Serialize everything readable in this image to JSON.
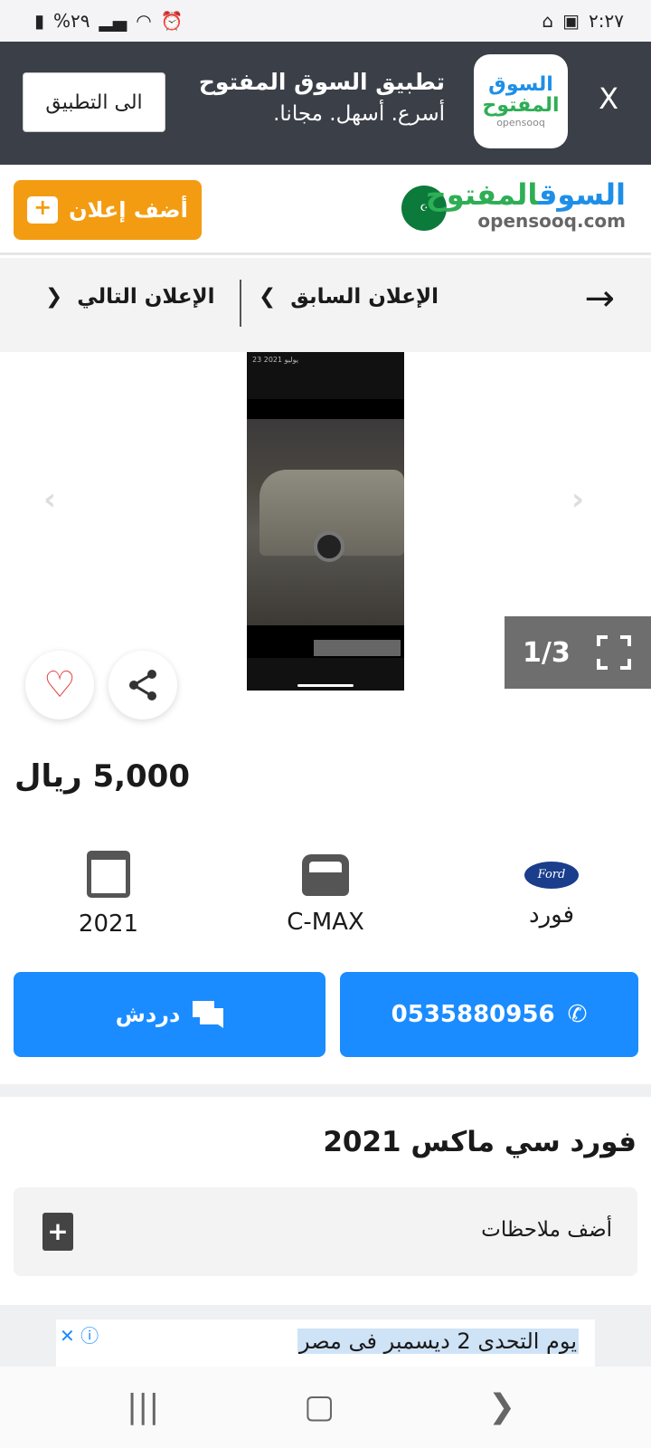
{
  "status_bar": {
    "battery": "%٢٩",
    "time": "٢:٢٧"
  },
  "app_banner": {
    "open_app": "الى التطبيق",
    "title": "تطبيق السوق المفتوح",
    "subtitle": "أسرع. أسهل. مجانا.",
    "logo_line1": "السوق",
    "logo_line2": "المفتوح",
    "logo_line3": "opensooq",
    "close": "X"
  },
  "header": {
    "post_ad": "أضف إعلان",
    "logo_blue": "السوق",
    "logo_green": "المفتوح",
    "logo_en": "opensooq.com"
  },
  "nav": {
    "next": "الإعلان التالي",
    "prev": "الإعلان السابق"
  },
  "gallery": {
    "counter": "1/3",
    "photo_date": "23 يوليو 2021"
  },
  "listing": {
    "price": "5,000 ريال",
    "year": "2021",
    "model": "C-MAX",
    "brand": "فورد",
    "brand_logo": "Ford",
    "phone": "0535880956",
    "chat": "دردش",
    "title": "فورد سي ماكس 2021",
    "add_notes": "أضف ملاحظات"
  },
  "ad": {
    "text": "يوم التحدى 2 ديسمبر فى مصر"
  },
  "colors": {
    "accent_blue": "#1a8cff",
    "post_orange": "#f39c12",
    "banner_dark": "#3a3f48"
  }
}
